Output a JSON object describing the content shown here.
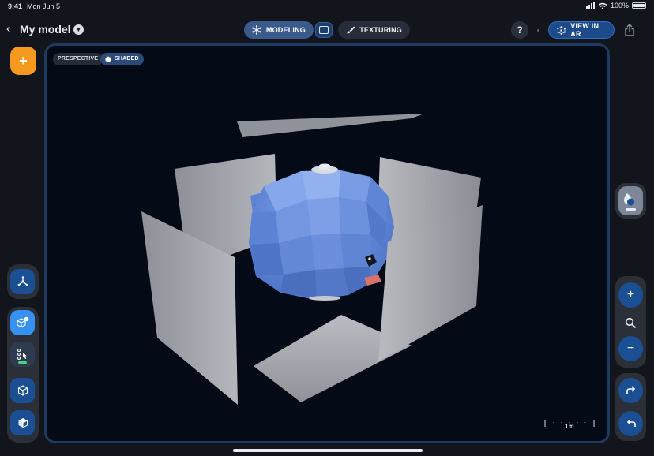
{
  "status_bar": {
    "time": "9:41",
    "date": "Mon Jun 5",
    "battery": "100%"
  },
  "header": {
    "back_icon": "chevron-left-icon",
    "title": "My model",
    "modes": [
      {
        "label": "MODELING",
        "icon": "network-icon",
        "active": true
      },
      {
        "label": "TEXTURING",
        "icon": "brush-icon",
        "active": false
      }
    ],
    "help_label": "?",
    "ar_button_label": "VIEW IN AR",
    "ar_icon": "ar-icon",
    "share_icon": "share-icon"
  },
  "viewport": {
    "projection_label": "PRESPECTIVE",
    "shading_label": "SHADED",
    "scale_label": "1m",
    "background": "#050b16",
    "model_color": "#5d86d8"
  },
  "toolbar_left": {
    "add_label": "+",
    "tools": [
      {
        "name": "transform-tool",
        "icon": "axes-icon"
      },
      {
        "name": "add-primitive-tool",
        "icon": "cube-plus-icon",
        "active": true
      },
      {
        "name": "select-vertex-tool",
        "icon": "vertex-select-icon"
      },
      {
        "name": "object-mode-tool",
        "icon": "cube-outline-icon"
      },
      {
        "name": "solid-mode-tool",
        "icon": "cube-solid-icon"
      }
    ]
  },
  "toolbar_right": {
    "paint_icon": "paint-drop-icon",
    "zoom_in_label": "+",
    "zoom_out_label": "−",
    "redo_icon": "redo-icon",
    "undo_icon": "undo-icon"
  },
  "colors": {
    "accent": "#3592f2",
    "add_button": "#f59a1f",
    "selection_indicator": "#4cd27a"
  }
}
